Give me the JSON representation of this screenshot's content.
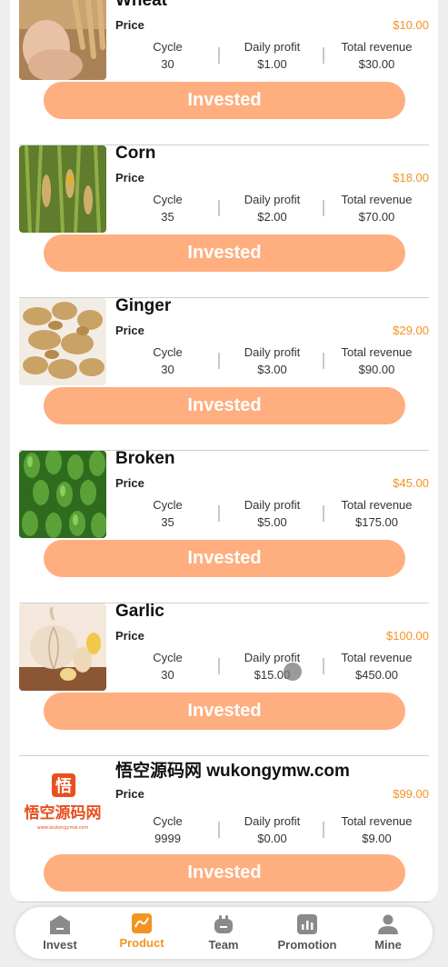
{
  "products": [
    {
      "name": "Wheat",
      "price_label": "Price",
      "price": "$10.00",
      "cycle_label": "Cycle",
      "cycle": "30",
      "daily_label": "Daily profit",
      "daily": "$1.00",
      "total_label": "Total revenue",
      "total": "$30.00",
      "button": "Invested",
      "image": "wheat-photo"
    },
    {
      "name": "Corn",
      "price_label": "Price",
      "price": "$18.00",
      "cycle_label": "Cycle",
      "cycle": "35",
      "daily_label": "Daily profit",
      "daily": "$2.00",
      "total_label": "Total revenue",
      "total": "$70.00",
      "button": "Invested",
      "image": "corn-photo"
    },
    {
      "name": "Ginger",
      "price_label": "Price",
      "price": "$29.00",
      "cycle_label": "Cycle",
      "cycle": "30",
      "daily_label": "Daily profit",
      "daily": "$3.00",
      "total_label": "Total revenue",
      "total": "$90.00",
      "button": "Invested",
      "image": "ginger-photo"
    },
    {
      "name": "Broken",
      "price_label": "Price",
      "price": "$45.00",
      "cycle_label": "Cycle",
      "cycle": "35",
      "daily_label": "Daily profit",
      "daily": "$5.00",
      "total_label": "Total revenue",
      "total": "$175.00",
      "button": "Invested",
      "image": "peppers-photo"
    },
    {
      "name": "Garlic",
      "price_label": "Price",
      "price": "$100.00",
      "cycle_label": "Cycle",
      "cycle": "30",
      "daily_label": "Daily profit",
      "daily": "$15.00",
      "total_label": "Total revenue",
      "total": "$450.00",
      "button": "Invested",
      "image": "garlic-photo"
    },
    {
      "name": "悟空源码网 wukongymw.com",
      "price_label": "Price",
      "price": "$99.00",
      "cycle_label": "Cycle",
      "cycle": "9999",
      "daily_label": "Daily profit",
      "daily": "$0.00",
      "total_label": "Total revenue",
      "total": "$9.00",
      "button": "Invested",
      "image": "wukong-logo",
      "logo_char": "悟",
      "logo_text": "悟空源码网",
      "logo_sub": "www.wukongymw.com"
    }
  ],
  "tabbar": [
    {
      "label": "Invest",
      "icon": "invest-icon"
    },
    {
      "label": "Product",
      "icon": "product-icon"
    },
    {
      "label": "Team",
      "icon": "team-icon"
    },
    {
      "label": "Promotion",
      "icon": "promotion-icon"
    },
    {
      "label": "Mine",
      "icon": "mine-icon"
    }
  ],
  "active_tab": "Product",
  "colors": {
    "accent": "#f39321",
    "button": "#ffae7f",
    "background": "#eeeeef",
    "icon_gray": "#8a8a8a"
  }
}
